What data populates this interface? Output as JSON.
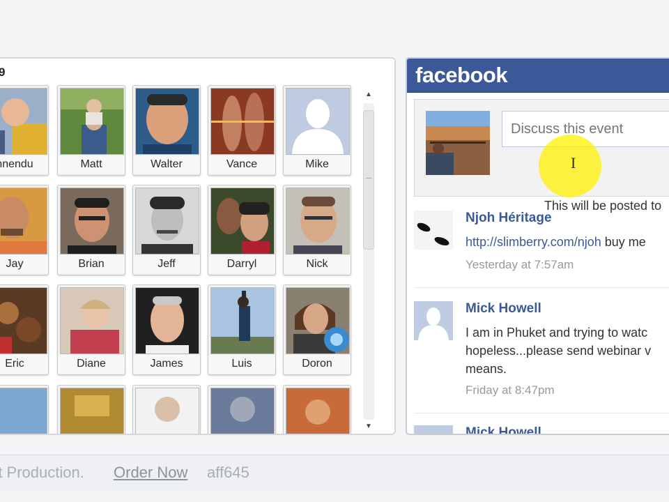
{
  "attendees": {
    "count_text": "9",
    "rows": [
      [
        {
          "name": "nnendu"
        },
        {
          "name": "Matt"
        },
        {
          "name": "Walter"
        },
        {
          "name": "Vance"
        },
        {
          "name": "Mike"
        }
      ],
      [
        {
          "name": "Jay"
        },
        {
          "name": "Brian"
        },
        {
          "name": "Jeff"
        },
        {
          "name": "Darryl"
        },
        {
          "name": "Nick"
        }
      ],
      [
        {
          "name": "Eric"
        },
        {
          "name": "Diane"
        },
        {
          "name": "James"
        },
        {
          "name": "Luis"
        },
        {
          "name": "Doron"
        }
      ]
    ],
    "scroll_up_icon": "triangle-up",
    "scroll_down_icon": "triangle-down"
  },
  "facebook": {
    "logo": "facebook",
    "brand_color": "#3b5998",
    "composer": {
      "placeholder": "Discuss this event",
      "note": "This will be posted to"
    },
    "posts": [
      {
        "author": "Njoh Héritage",
        "link": "http://slimberry.com/njoh",
        "text_after_link": " buy me",
        "time": "Yesterday at 7:57am"
      },
      {
        "author": "Mick Howell",
        "lines": [
          "I am in Phuket and trying to watc",
          "hopeless...please send webinar v",
          "means."
        ],
        "time": "Friday at 8:47pm"
      },
      {
        "author": "Mick Howell"
      }
    ]
  },
  "footer": {
    "production_text": "rt Production.",
    "order_link": "Order Now",
    "code": "aff645"
  }
}
